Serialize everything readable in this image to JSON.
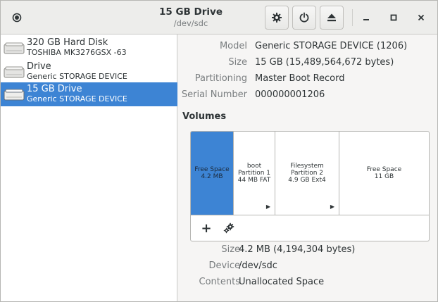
{
  "header": {
    "title": "15 GB Drive",
    "subtitle": "/dev/sdc"
  },
  "toolbar_icons": [
    "menu-icon",
    "gear-icon",
    "power-icon",
    "eject-icon",
    "minimize-icon",
    "maximize-icon",
    "close-icon"
  ],
  "sidebar": {
    "items": [
      {
        "name": "320 GB Hard Disk",
        "sub": "TOSHIBA MK3276GSX -63",
        "selected": false
      },
      {
        "name": "Drive",
        "sub": "Generic STORAGE DEVICE",
        "selected": false
      },
      {
        "name": "15 GB Drive",
        "sub": "Generic STORAGE DEVICE",
        "selected": true
      }
    ]
  },
  "details": {
    "model_label": "Model",
    "model": "Generic STORAGE DEVICE (1206)",
    "size_label": "Size",
    "size": "15 GB (15,489,564,672 bytes)",
    "partitioning_label": "Partitioning",
    "partitioning": "Master Boot Record",
    "serial_label": "Serial Number",
    "serial": "000000001206"
  },
  "volumes": {
    "heading": "Volumes",
    "segments": [
      {
        "line1": "Free Space",
        "line2": "4.2 MB",
        "line3": "",
        "selected": true,
        "has_arrow": false
      },
      {
        "line1": "boot",
        "line2": "Partition 1",
        "line3": "44 MB FAT",
        "selected": false,
        "has_arrow": true
      },
      {
        "line1": "Filesystem",
        "line2": "Partition 2",
        "line3": "4.9 GB Ext4",
        "selected": false,
        "has_arrow": true
      },
      {
        "line1": "Free Space",
        "line2": "11 GB",
        "line3": "",
        "selected": false,
        "has_arrow": false
      }
    ],
    "arrow_glyph": "▶",
    "add_glyph": "+"
  },
  "selected_volume": {
    "size_label": "Size",
    "size": "4.2 MB (4,194,304 bytes)",
    "device_label": "Device",
    "device": "/dev/sdc",
    "contents_label": "Contents",
    "contents": "Unallocated Space"
  },
  "colors": {
    "accent": "#3d84d4",
    "dim_label": "#797d7f"
  }
}
